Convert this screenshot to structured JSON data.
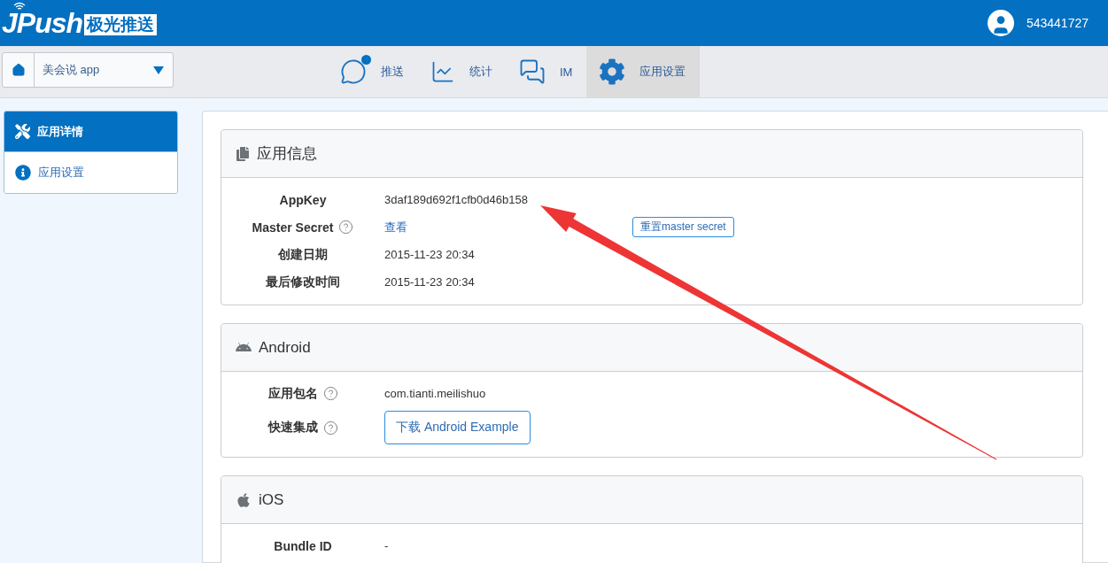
{
  "header": {
    "logo": {
      "brand": "JPush",
      "tagline": "极光推送"
    },
    "user": {
      "name": "543441727"
    }
  },
  "app_switcher": {
    "value": "美会说 app"
  },
  "nav_tabs": [
    {
      "label": "推送",
      "dot": true,
      "selected": false
    },
    {
      "label": "统计",
      "dot": false,
      "selected": false
    },
    {
      "label": "IM",
      "dot": false,
      "selected": false
    },
    {
      "label": "应用设置",
      "dot": false,
      "selected": true
    }
  ],
  "sidebar": {
    "items": [
      {
        "label": "应用详情",
        "selected": true
      },
      {
        "label": "应用设置",
        "selected": false
      }
    ]
  },
  "sections": [
    {
      "title": "应用信息",
      "rows": [
        {
          "label": "AppKey",
          "help": false,
          "kind": "text",
          "value": "3daf189d692f1cfb0d46b158"
        },
        {
          "label": "Master Secret",
          "help": true,
          "kind": "link",
          "value": "查看",
          "action": "重置master secret"
        },
        {
          "label": "创建日期",
          "help": false,
          "kind": "text",
          "value": "2015-11-23 20:34"
        },
        {
          "label": "最后修改时间",
          "help": false,
          "kind": "text",
          "value": "2015-11-23 20:34"
        }
      ]
    },
    {
      "title": "Android",
      "rows": [
        {
          "label": "应用包名",
          "help": true,
          "kind": "text",
          "value": "com.tianti.meilishuo"
        },
        {
          "label": "快速集成",
          "help": true,
          "kind": "button",
          "value": "下载 Android Example"
        }
      ]
    },
    {
      "title": "iOS",
      "rows": [
        {
          "label": "Bundle ID",
          "help": false,
          "kind": "text",
          "value": "-"
        }
      ]
    }
  ]
}
